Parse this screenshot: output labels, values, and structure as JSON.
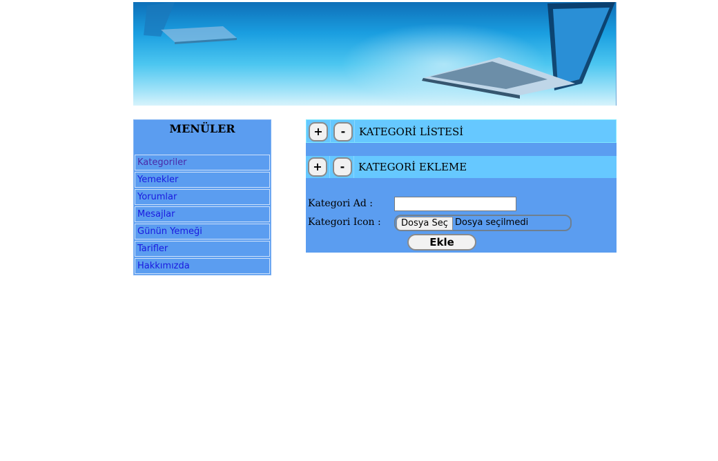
{
  "colors": {
    "menu_bg": "#5b9df0",
    "bar_bg": "#66c8ff",
    "link": "#1a1adf",
    "visited_link": "#4a2aa8"
  },
  "banner": {
    "image": "laptop-banner"
  },
  "menu": {
    "title": "MENÜLER",
    "items": [
      {
        "label": "Kategoriler"
      },
      {
        "label": "Yemekler"
      },
      {
        "label": "Yorumlar"
      },
      {
        "label": "Mesajlar"
      },
      {
        "label": "Günün Yemeği"
      },
      {
        "label": "Tarifler"
      },
      {
        "label": "Hakkımızda"
      }
    ]
  },
  "sections": {
    "list": {
      "plus": "+",
      "minus": "-",
      "title": "KATEGORİ LİSTESİ"
    },
    "add": {
      "plus": "+",
      "minus": "-",
      "title": "KATEGORİ EKLEME"
    }
  },
  "form": {
    "name_label": "Kategori Ad :",
    "name_value": "",
    "icon_label": "Kategori Icon :",
    "file_button": "Dosya Seç",
    "file_status": "Dosya seçilmedi",
    "submit_label": "Ekle"
  }
}
